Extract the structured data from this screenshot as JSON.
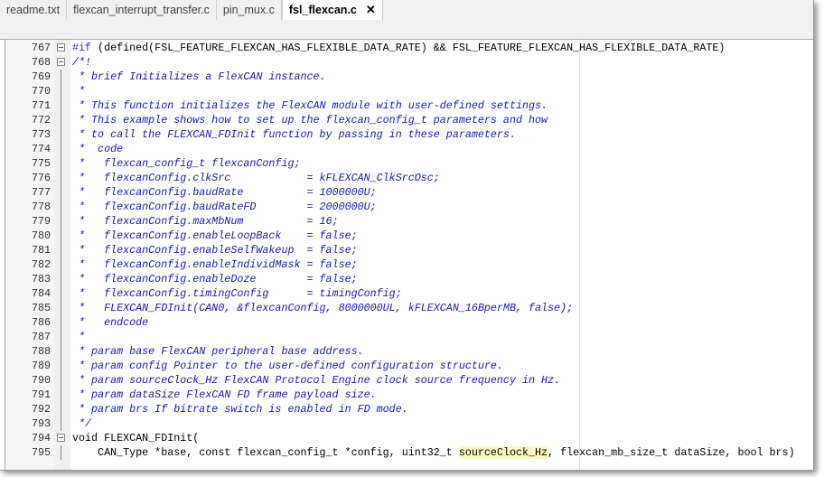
{
  "tabs": [
    {
      "label": "readme.txt"
    },
    {
      "label": "flexcan_interrupt_transfer.c"
    },
    {
      "label": "pin_mux.c"
    },
    {
      "label": "fsl_flexcan.c",
      "active": true,
      "close": "✕"
    }
  ],
  "lines": [
    {
      "n": "767",
      "fold": "box",
      "parts": [
        {
          "t": "#if",
          "c": "pre"
        },
        {
          "t": " (defined(FSL_FEATURE_FLEXCAN_HAS_FLEXIBLE_DATA_RATE) && FSL_FEATURE_FLEXCAN_HAS_FLEXIBLE_DATA_RATE)",
          "c": "plain"
        }
      ]
    },
    {
      "n": "768",
      "fold": "box",
      "parts": [
        {
          "t": "/*!",
          "c": "comment"
        }
      ]
    },
    {
      "n": "769",
      "fold": "line",
      "parts": [
        {
          "t": " * brief Initializes a FlexCAN instance.",
          "c": "comment"
        }
      ]
    },
    {
      "n": "770",
      "fold": "line",
      "parts": [
        {
          "t": " *",
          "c": "comment"
        }
      ]
    },
    {
      "n": "771",
      "fold": "line",
      "parts": [
        {
          "t": " * This function initializes the FlexCAN module with user-defined settings.",
          "c": "comment"
        }
      ]
    },
    {
      "n": "772",
      "fold": "line",
      "parts": [
        {
          "t": " * This example shows how to set up the flexcan_config_t parameters and how",
          "c": "comment"
        }
      ]
    },
    {
      "n": "773",
      "fold": "line",
      "parts": [
        {
          "t": " * to call the FLEXCAN_FDInit function by passing in these parameters.",
          "c": "comment"
        }
      ]
    },
    {
      "n": "774",
      "fold": "line",
      "parts": [
        {
          "t": " *  code",
          "c": "comment"
        }
      ]
    },
    {
      "n": "775",
      "fold": "line",
      "parts": [
        {
          "t": " *   flexcan_config_t flexcanConfig;",
          "c": "comment"
        }
      ]
    },
    {
      "n": "776",
      "fold": "line",
      "parts": [
        {
          "t": " *   flexcanConfig.clkSrc            = kFLEXCAN_ClkSrcOsc;",
          "c": "comment"
        }
      ]
    },
    {
      "n": "777",
      "fold": "line",
      "parts": [
        {
          "t": " *   flexcanConfig.baudRate          = 1000000U;",
          "c": "comment"
        }
      ]
    },
    {
      "n": "778",
      "fold": "line",
      "parts": [
        {
          "t": " *   flexcanConfig.baudRateFD        = 2000000U;",
          "c": "comment"
        }
      ]
    },
    {
      "n": "779",
      "fold": "line",
      "parts": [
        {
          "t": " *   flexcanConfig.maxMbNum          = 16;",
          "c": "comment"
        }
      ]
    },
    {
      "n": "780",
      "fold": "line",
      "parts": [
        {
          "t": " *   flexcanConfig.enableLoopBack    = false;",
          "c": "comment"
        }
      ]
    },
    {
      "n": "781",
      "fold": "line",
      "parts": [
        {
          "t": " *   flexcanConfig.enableSelfWakeup  = false;",
          "c": "comment"
        }
      ]
    },
    {
      "n": "782",
      "fold": "line",
      "parts": [
        {
          "t": " *   flexcanConfig.enableIndividMask = false;",
          "c": "comment"
        }
      ]
    },
    {
      "n": "783",
      "fold": "line",
      "parts": [
        {
          "t": " *   flexcanConfig.enableDoze        = false;",
          "c": "comment"
        }
      ]
    },
    {
      "n": "784",
      "fold": "line",
      "parts": [
        {
          "t": " *   flexcanConfig.timingConfig      = timingConfig;",
          "c": "comment"
        }
      ]
    },
    {
      "n": "785",
      "fold": "line",
      "parts": [
        {
          "t": " *   FLEXCAN_FDInit(CAN0, &flexcanConfig, 8000000UL, kFLEXCAN_16BperMB, false);",
          "c": "comment"
        }
      ]
    },
    {
      "n": "786",
      "fold": "line",
      "parts": [
        {
          "t": " *   endcode",
          "c": "comment"
        }
      ]
    },
    {
      "n": "787",
      "fold": "line",
      "parts": [
        {
          "t": " *",
          "c": "comment"
        }
      ]
    },
    {
      "n": "788",
      "fold": "line",
      "parts": [
        {
          "t": " * param base FlexCAN peripheral base address.",
          "c": "comment"
        }
      ]
    },
    {
      "n": "789",
      "fold": "line",
      "parts": [
        {
          "t": " * param config Pointer to the user-defined configuration structure.",
          "c": "comment"
        }
      ]
    },
    {
      "n": "790",
      "fold": "line",
      "parts": [
        {
          "t": " * param sourceClock_Hz FlexCAN Protocol Engine clock source frequency in Hz.",
          "c": "comment"
        }
      ]
    },
    {
      "n": "791",
      "fold": "line",
      "parts": [
        {
          "t": " * param dataSize FlexCAN FD frame payload size.",
          "c": "comment"
        }
      ]
    },
    {
      "n": "792",
      "fold": "line",
      "parts": [
        {
          "t": " * param brs If bitrate switch is enabled in FD mode.",
          "c": "comment"
        }
      ]
    },
    {
      "n": "793",
      "fold": "line",
      "parts": [
        {
          "t": " */",
          "c": "comment"
        }
      ]
    },
    {
      "n": "794",
      "fold": "box",
      "parts": [
        {
          "t": "void FLEXCAN_FDInit(",
          "c": "plain"
        }
      ]
    },
    {
      "n": "795",
      "fold": "line",
      "parts": [
        {
          "t": "    CAN_Type *base, const flexcan_config_t *config, uint32_t ",
          "c": "plain"
        },
        {
          "t": "sourceClock_Hz",
          "c": "hl"
        },
        {
          "t": ", flexcan_mb_size_t dataSize, bool brs)",
          "c": "plain"
        }
      ]
    }
  ]
}
